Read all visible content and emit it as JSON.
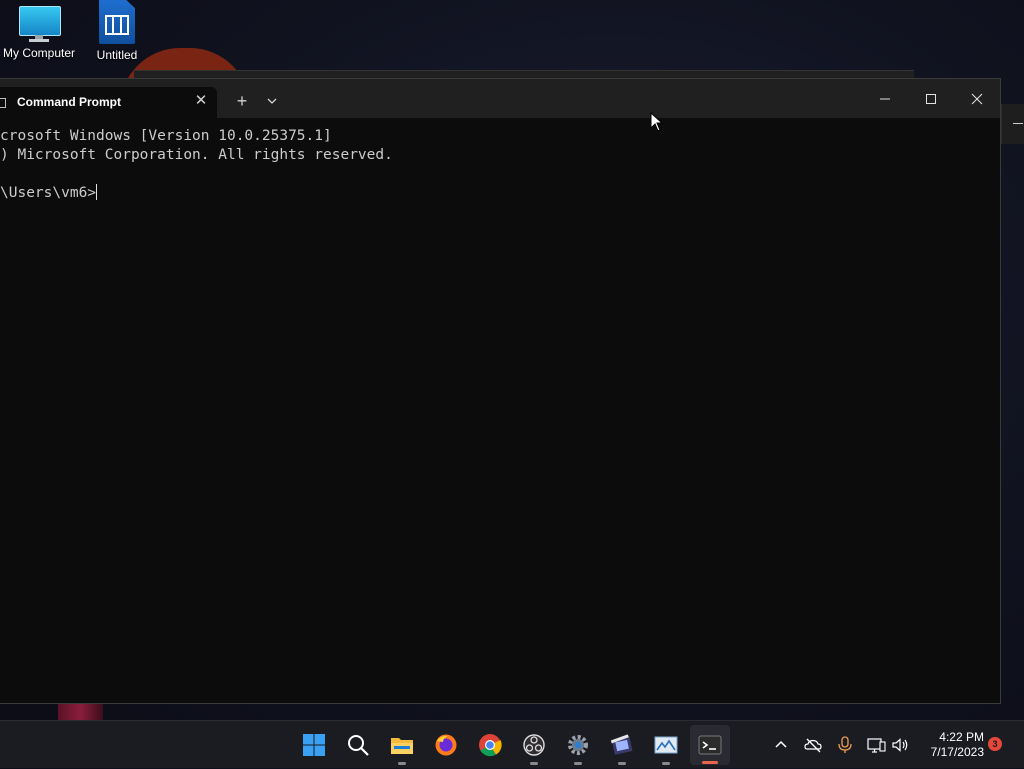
{
  "desktop": {
    "icons": [
      {
        "label": "My Computer"
      },
      {
        "label": "Untitled"
      }
    ]
  },
  "terminal": {
    "tab_title": "Command Prompt",
    "lines": [
      "crosoft Windows [Version 10.0.25375.1]",
      ") Microsoft Corporation. All rights reserved.",
      "",
      "\\Users\\vm6>"
    ],
    "new_tab_glyph": "+",
    "close_glyph": "✕"
  },
  "taskbar": {
    "items": [
      "start-icon",
      "search-icon",
      "file-explorer-icon",
      "firefox-icon",
      "chrome-icon",
      "obs-icon",
      "settings-icon",
      "video-editor-icon",
      "photos-icon",
      "terminal-icon"
    ],
    "clock_time": "4:22 PM",
    "clock_date": "7/17/2023",
    "notification_count": "3"
  },
  "colors": {
    "terminal_bg": "#0c0c0c",
    "titlebar_bg": "#202020",
    "taskbar_bg": "#1b1c22",
    "accent": "#e8654d"
  }
}
